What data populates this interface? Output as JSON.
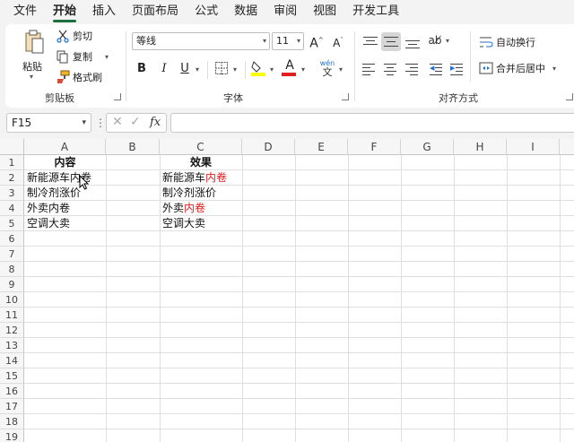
{
  "menu": [
    "文件",
    "开始",
    "插入",
    "页面布局",
    "公式",
    "数据",
    "审阅",
    "视图",
    "开发工具"
  ],
  "ribbon": {
    "clipboard": {
      "paste": "粘贴",
      "cut": "剪切",
      "copy": "复制",
      "format_painter": "格式刷",
      "label": "剪贴板"
    },
    "font": {
      "name": "等线",
      "size": "11",
      "grow": "A",
      "shrink": "A",
      "bold": "B",
      "italic": "I",
      "underline": "U",
      "font_color_letter": "A",
      "phonetic": "wén",
      "label": "字体"
    },
    "alignment": {
      "wrap_text": "自动换行",
      "merge_center": "合并后居中",
      "label": "对齐方式"
    }
  },
  "formula_bar": {
    "name_box": "F15",
    "fx": "fx",
    "formula": ""
  },
  "columns": [
    "A",
    "B",
    "C",
    "D",
    "E",
    "F",
    "G",
    "H",
    "I"
  ],
  "rows": [
    "1",
    "2",
    "3",
    "4",
    "5",
    "6",
    "7",
    "8",
    "9",
    "10",
    "11",
    "12",
    "13",
    "14",
    "15",
    "16",
    "17",
    "18",
    "19"
  ],
  "cells": {
    "A1": "内容",
    "C1": "效果",
    "A2": "新能源车内卷",
    "A3": "制冷剂涨价",
    "A4": "外卖内卷",
    "A5": "空调大卖",
    "C2_plain": "新能源车",
    "C2_red": "内卷",
    "C3": "制冷剂涨价",
    "C4_plain": "外卖",
    "C4_red": "内卷",
    "C5": "空调大卖"
  },
  "colors": {
    "accent": "#1e6f3e",
    "highlight_red": "#e02020",
    "fill_yellow": "#ffff00",
    "font_red": "#e02020"
  }
}
